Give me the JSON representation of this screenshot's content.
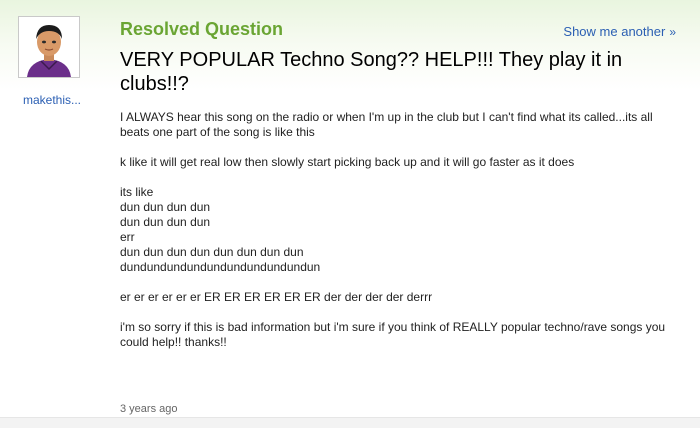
{
  "header": {
    "status_title": "Resolved Question",
    "show_another": "Show me another",
    "show_another_icon": "chevron-right-icon"
  },
  "asker": {
    "username": "makethis...",
    "avatar_icon": "avatar-icon"
  },
  "question": {
    "title": "VERY POPULAR Techno Song?? HELP!!! They play it in clubs!!?",
    "paragraphs": [
      [
        "I ALWAYS hear this song on the radio or when I'm up in the club but I can't find what its called...its all beats one part of the song is like this"
      ],
      [
        "k like it will get real low then slowly start picking back up and it will go faster as it does"
      ],
      [
        "its like",
        "dun dun dun dun",
        "dun dun dun dun",
        "err",
        "dun dun dun dun dun dun dun dun",
        "dundundundundundundundundundun"
      ],
      [
        "er er er er er er ER ER ER ER ER ER der der der der derrr"
      ],
      [
        "i'm so sorry if this is bad information but i'm sure if you think of REALLY popular techno/rave songs you could help!! thanks!!"
      ]
    ],
    "timestamp": "3 years ago"
  },
  "colors": {
    "status_green": "#6aa533",
    "link_blue": "#2b5fb3",
    "header_gradient_top": "#e9f5df"
  }
}
